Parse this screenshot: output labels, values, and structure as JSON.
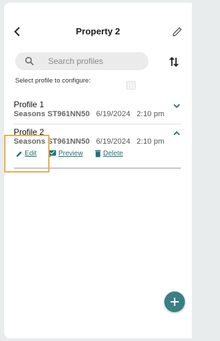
{
  "header": {
    "title": "Property 2"
  },
  "search": {
    "placeholder": "Search profiles"
  },
  "hint": "Select profile to configure:",
  "profiles": [
    {
      "name": "Profile 1",
      "season_label": "Seasons",
      "code": "ST961NN50",
      "date": "6/19/2024",
      "time": "2:10 pm",
      "expanded": false
    },
    {
      "name": "Profile 2",
      "season_label": "Seasons",
      "code": "ST961NN50",
      "date": "6/19/2024",
      "time": "2:10 pm",
      "expanded": true
    }
  ],
  "actions": {
    "edit": "Edit",
    "preview": "Preview",
    "delete": "Delete"
  },
  "colors": {
    "accent": "#1f6f73",
    "fab": "#3a7f85",
    "highlight": "#e6b24f"
  },
  "icons": [
    "back-arrow-icon",
    "pencil-icon",
    "search-icon",
    "sort-icon",
    "chevron-down-icon",
    "chevron-up-icon",
    "preview-icon",
    "trash-icon",
    "plus-icon"
  ]
}
